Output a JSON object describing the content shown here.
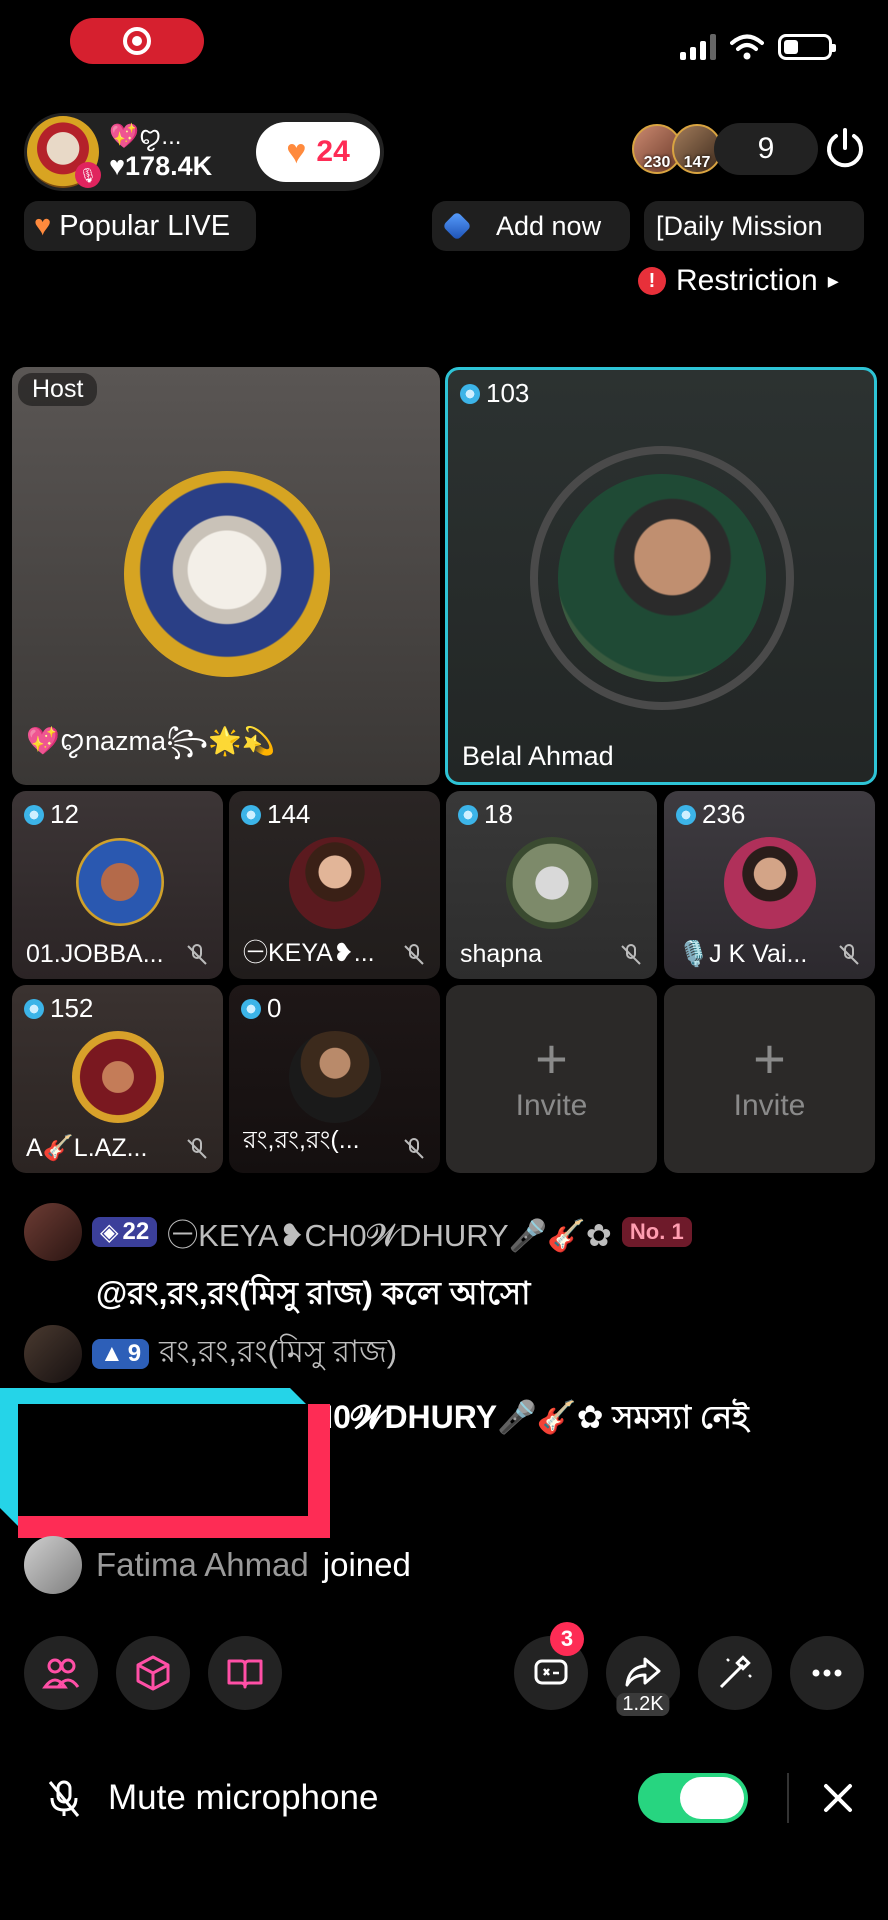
{
  "status": {
    "record_icon": "screen-record-icon",
    "signal": "signal-icon",
    "wifi": "wifi-icon",
    "battery": "battery-icon"
  },
  "host": {
    "name": "💖ꨄ︎...",
    "likes": "♥178.4K",
    "like_count": "24"
  },
  "viewers": {
    "avatar1_count": "230",
    "avatar2_count": "147",
    "total": "9"
  },
  "chips": {
    "popular": "Popular LIVE",
    "add_now": "Add now",
    "daily": "[Daily Mission"
  },
  "restriction": {
    "label": "Restriction",
    "arrow": "▸"
  },
  "seats": {
    "host_tag": "Host",
    "host_name": "💖ꨄ︎nazma꧂🌟💫",
    "guest_score": "103",
    "guest_name": "Belal Ahmad",
    "row1": [
      {
        "score": "12",
        "name": "01.JOBBA..."
      },
      {
        "score": "144",
        "name": "㊀KEYA❥..."
      },
      {
        "score": "18",
        "name": "shapna"
      },
      {
        "score": "236",
        "name": "🎙️J K Vai..."
      }
    ],
    "row2": [
      {
        "score": "152",
        "name": "A🎸L.AZ..."
      },
      {
        "score": "0",
        "name": "রং,রং,রং(..."
      }
    ],
    "invite_label": "Invite",
    "invite_plus": "+"
  },
  "chat": [
    {
      "level": "22",
      "user": "㊀KEYA❥CH0𝓦DHURY🎤🎸✿",
      "badge": "No. 1",
      "message": "@রং,রং,রং(মিসু রাজ) কলে আসো"
    },
    {
      "level": "9",
      "user": "রং,রং,রং(মিসু রাজ)",
      "message": "H0𝓦DHURY🎤🎸✿ সমস্যা নেই"
    }
  ],
  "joined": {
    "name": "Fatima Ahmad",
    "text": "joined"
  },
  "toolbar": {
    "chat_badge": "3",
    "share_count": "1.2K"
  },
  "mute": {
    "label": "Mute microphone",
    "close": "✕"
  },
  "colors": {
    "accent": "#fe2c55",
    "toggle_on": "#27d580",
    "seat_border": "#2ec4d6",
    "record": "#d6202f"
  }
}
